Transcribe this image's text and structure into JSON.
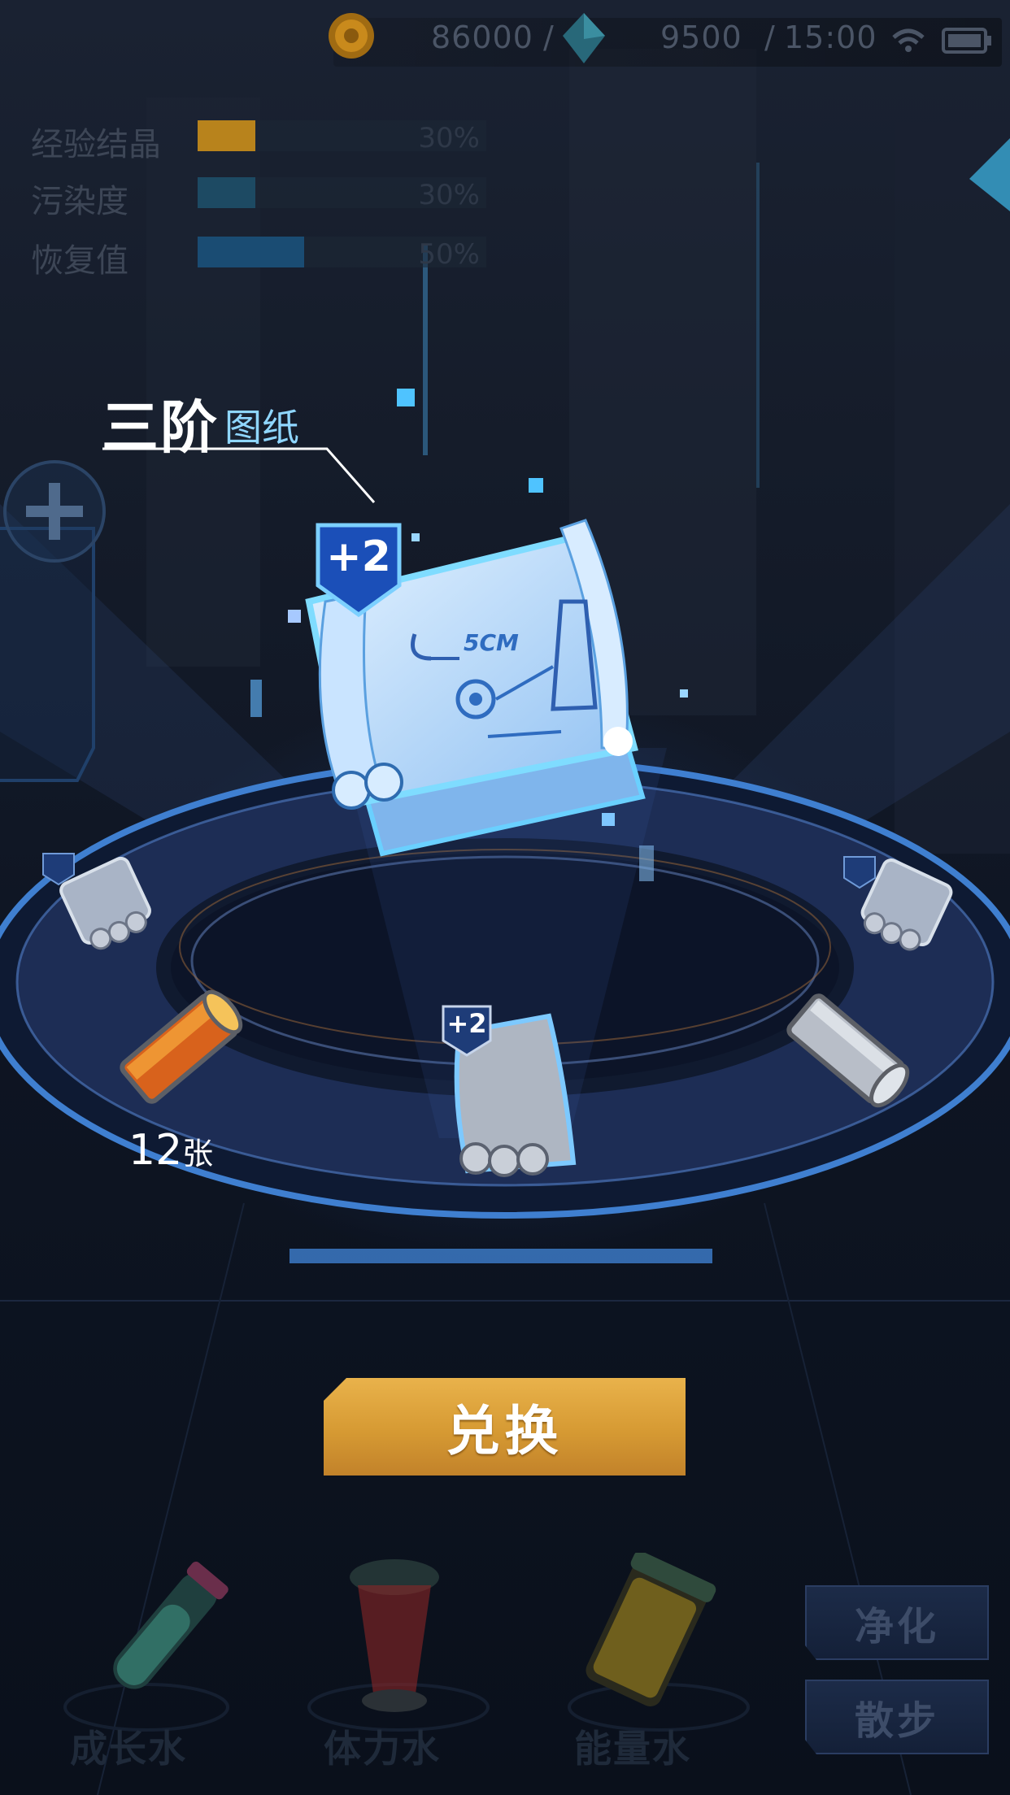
{
  "status_bar": {
    "gold": "86000",
    "crystals": "9500",
    "time": "15:00",
    "separator": "/"
  },
  "stats": [
    {
      "label": "经验结晶",
      "percent_text": "30%",
      "fill": 0.2,
      "color": "#b8831c"
    },
    {
      "label": "污染度",
      "percent_text": "30%",
      "fill": 0.2,
      "color": "#1d4a63"
    },
    {
      "label": "恢复值",
      "percent_text": "50%",
      "fill": 0.37,
      "color": "#1a4c73"
    }
  ],
  "item_title": {
    "tier": "三阶",
    "type": "图纸"
  },
  "blueprint": {
    "badge": "+2",
    "scale_text": "5CM"
  },
  "carousel": {
    "count_number": "12",
    "count_unit": "张",
    "small_badge": "+2"
  },
  "buttons": {
    "exchange": "兑换",
    "purify": "净化",
    "walk": "散步"
  },
  "potions": [
    {
      "label": "成长水",
      "color": "#3e8f80"
    },
    {
      "label": "体力水",
      "color": "#8a2626"
    },
    {
      "label": "能量水",
      "color": "#a78a1e"
    }
  ],
  "colors": {
    "accent_blue": "#58c8ff",
    "button_gold": "#d69a33",
    "platform": "#1d2d55"
  }
}
